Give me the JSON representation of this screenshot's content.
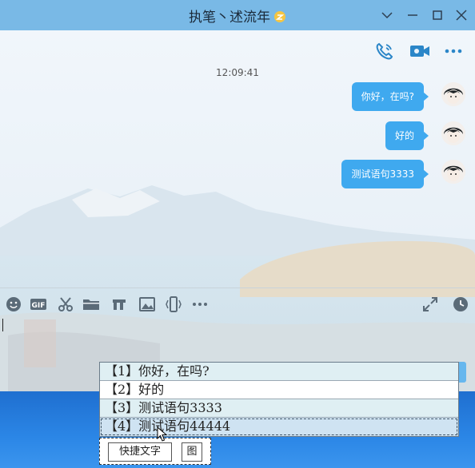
{
  "window": {
    "title": "执笔丶述流年",
    "controls": [
      "chevron-down-icon",
      "minimize-icon",
      "maximize-icon",
      "close-icon"
    ]
  },
  "header_actions": [
    "phone-call-icon",
    "video-call-icon",
    "more-icon"
  ],
  "chat": {
    "timestamp": "12:09:41",
    "messages": [
      {
        "text": "你好，在吗?",
        "from": "me"
      },
      {
        "text": "好的",
        "from": "me"
      },
      {
        "text": "测试语句3333",
        "from": "me"
      }
    ]
  },
  "toolbar": {
    "left": [
      "emoji-icon",
      "gif-icon",
      "scissors-icon",
      "folder-icon",
      "music-icon",
      "image-icon",
      "shake-icon",
      "more-icon"
    ],
    "right": [
      "expand-icon",
      "history-clock-icon"
    ]
  },
  "quick_reply": {
    "items": [
      "【1】你好，在吗?",
      "【2】好的",
      "【3】测试语句3333",
      "【4】测试语句44444"
    ],
    "selected_index": 3,
    "buttons": {
      "quick_text": "快捷文字",
      "image": "图"
    }
  },
  "colors": {
    "titlebar": "#79b9e6",
    "bubble": "#3fa9ef",
    "icon": "#2b86c8"
  }
}
